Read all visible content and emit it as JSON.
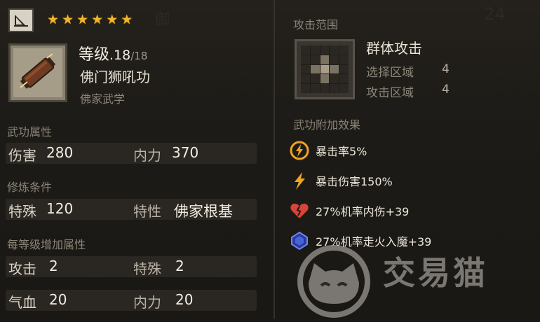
{
  "header": {
    "stars": 6
  },
  "skill": {
    "level_label": "等级",
    "level_value": ".18",
    "level_max": "/18",
    "name": "佛门狮吼功",
    "category": "佛家武学"
  },
  "attributes": {
    "title": "武功属性",
    "damage_label": "伤害",
    "damage_value": "280",
    "inner_label": "内力",
    "inner_value": "370"
  },
  "requirements": {
    "title": "修炼条件",
    "special_label": "特殊",
    "special_value": "120",
    "trait_label": "特性",
    "trait_value": "佛家根基"
  },
  "per_level": {
    "title": "每等级增加属性",
    "attack_label": "攻击",
    "attack_value": "2",
    "special_label": "特殊",
    "special_value": "2",
    "hp_label": "气血",
    "hp_value": "20",
    "inner_label": "内力",
    "inner_value": "20"
  },
  "range": {
    "title": "攻击范围",
    "type": "群体攻击",
    "select_label": "选择区域",
    "select_value": "4",
    "attack_label": "攻击区域",
    "attack_value": "4"
  },
  "effects": {
    "title": "武功附加效果",
    "items": [
      {
        "text": "暴击率5%",
        "icon": "lightning-circle-icon"
      },
      {
        "text": "暴击伤害150%",
        "icon": "lightning-icon"
      },
      {
        "text": "27%机率内伤+39",
        "icon": "broken-heart-icon"
      },
      {
        "text": "27%机率走火入魔+39",
        "icon": "blue-gem-icon"
      }
    ]
  },
  "watermark": {
    "text": "交易猫"
  },
  "colors": {
    "star": "#f2b62a",
    "accent_orange": "#f0a323",
    "heart_red": "#d8433a",
    "gem_blue": "#4a64d8"
  }
}
